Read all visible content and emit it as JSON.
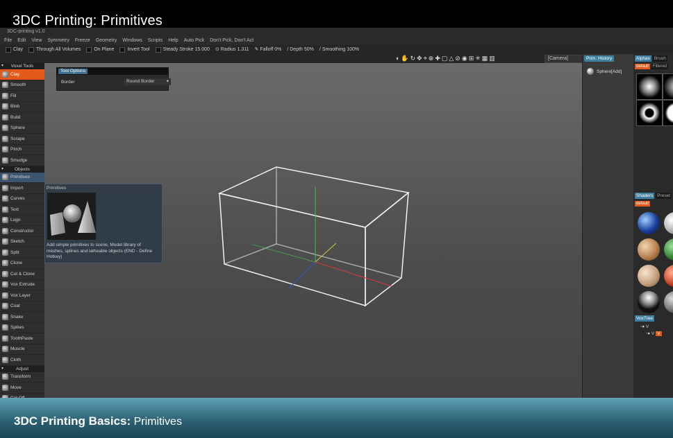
{
  "video": {
    "title": "3DC Printing: Primitives",
    "banner_bold": "3DC Printing Basics:",
    "banner_rest": " Primitives"
  },
  "app": {
    "window_title": "3DC-printing v1.0",
    "menu": [
      "File",
      "Edit",
      "View",
      "Symmetry",
      "Freeze",
      "Geometry",
      "Windows",
      "Scripts",
      "Help",
      "Auto Pick",
      "Don't Pick, Don't Act"
    ],
    "toolbar": {
      "tool": "Clay",
      "through_all": "Through All Volumes",
      "on_plane": "On Plane",
      "invert_tool": "Invert Tool",
      "steady_stroke": "Steady Stroke",
      "steady_value": "15.000",
      "radius_label": "Radius",
      "radius_value": "1.311",
      "falloff_label": "Falloff",
      "falloff_value": "0%",
      "depth_label": "Depth",
      "depth_value": "50%",
      "smoothing_label": "Smoothing",
      "smoothing_value": "100%"
    },
    "camera": "[Camera]"
  },
  "left_panel": {
    "voxel_header": "Voxel Tools",
    "voxel_tools": [
      "Clay",
      "Smooth",
      "Fill",
      "Blob",
      "Build",
      "Sphere",
      "Scrape",
      "Pinch",
      "Smudge"
    ],
    "objects_header": "Objects",
    "object_tools": [
      "Primitives",
      "Import",
      "Curves",
      "Text",
      "Logo",
      "Constructor",
      "Sketch",
      "Split",
      "Clone",
      "Cut & Clone",
      "Vox Extrude",
      "Vox Layer",
      "Coat",
      "Snake",
      "Spikes",
      "ToothPaste",
      "Muscle",
      "Cloth"
    ],
    "adjust_header": "Adjust",
    "adjust_tools": [
      "Transform",
      "Move",
      "Cut Off"
    ]
  },
  "tool_options": {
    "tab": "Tool Options",
    "border_label": "Border",
    "border_value": "Round Border"
  },
  "tooltip": {
    "title": "Primitives",
    "description": "Add simple primitives to scene, Model library of meshes, splines and latheable objects (END - Define Hotkey)"
  },
  "right_panels": {
    "history_tab": "Prim. History",
    "history_item": "Sphere[Add]",
    "alphas_tab": "Alphas",
    "brush_tab": "Brush",
    "default_tag": "default",
    "filtered_tag": "Filtered",
    "shaders_tab": "Shaders",
    "presets_tab": "Preset",
    "voxtree_tab": "VoxTree",
    "voxtree_item": "V"
  },
  "colors": {
    "accent_orange": "#e35a1c",
    "tab_blue": "#3f7fa0",
    "banner_top": "#5fa3b6",
    "banner_bottom": "#1d4655"
  }
}
